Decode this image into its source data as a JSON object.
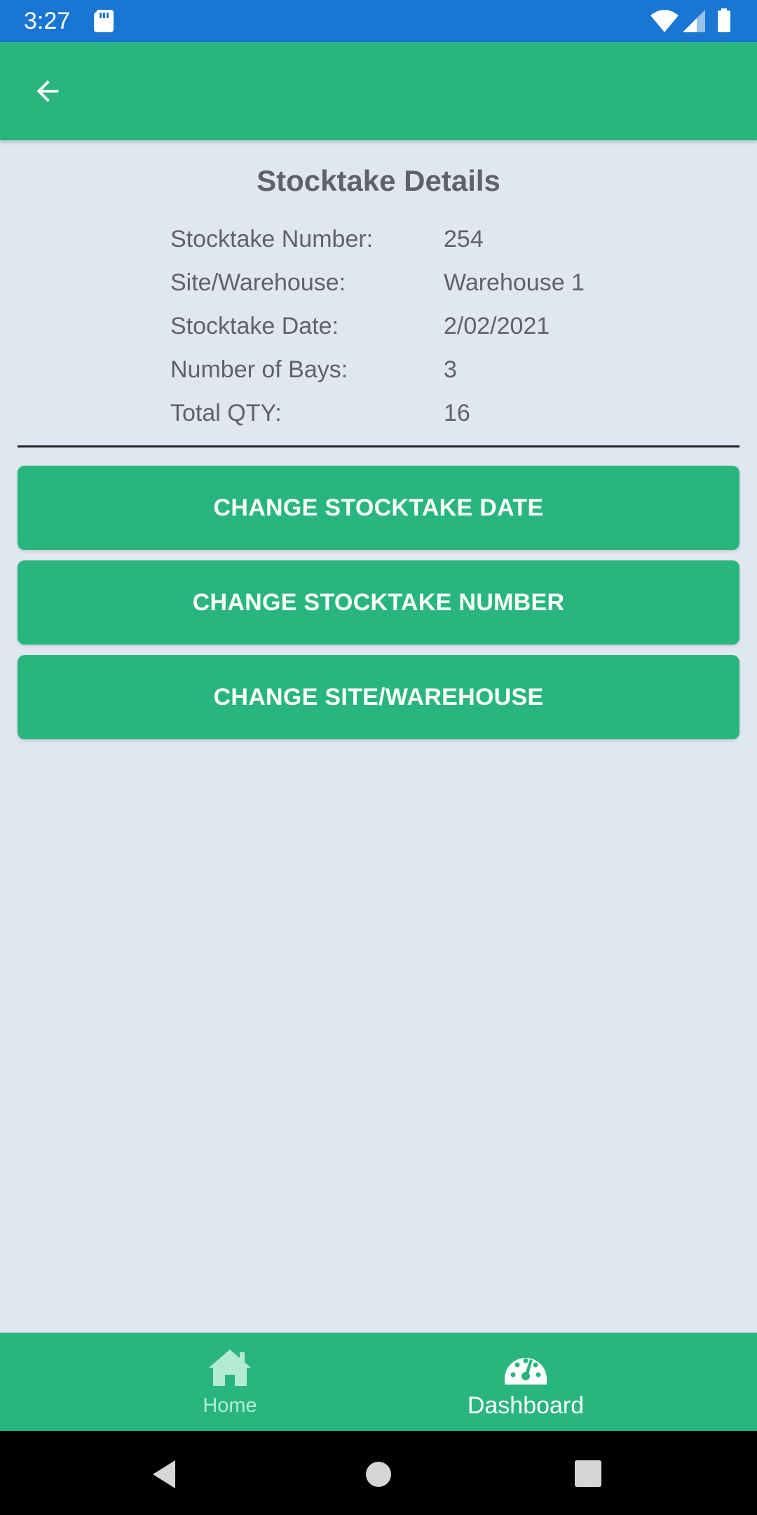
{
  "status_bar": {
    "time": "3:27",
    "icons": [
      "sd-card-icon",
      "wifi-icon",
      "cell-signal-icon",
      "battery-icon"
    ],
    "background_color": "#1976D2"
  },
  "app_bar": {
    "back_icon": "arrow-back-icon",
    "background_color": "#28B67E"
  },
  "page": {
    "title": "Stocktake Details"
  },
  "details": [
    {
      "label": "Stocktake Number:",
      "value": "254"
    },
    {
      "label": "Site/Warehouse:",
      "value": "Warehouse 1"
    },
    {
      "label": "Stocktake Date:",
      "value": "2/02/2021"
    },
    {
      "label": "Number of Bays:",
      "value": "3"
    },
    {
      "label": "Total QTY:",
      "value": "16"
    }
  ],
  "actions": {
    "change_date": "CHANGE STOCKTAKE DATE",
    "change_number": "CHANGE STOCKTAKE NUMBER",
    "change_site": "CHANGE SITE/WAREHOUSE"
  },
  "bottom_nav": {
    "items": [
      {
        "label": "Home",
        "icon": "home-icon",
        "active": false
      },
      {
        "label": "Dashboard",
        "icon": "dashboard-gauge-icon",
        "active": true
      }
    ]
  },
  "system_nav": {
    "icons": [
      "back-triangle-icon",
      "home-circle-icon",
      "recents-square-icon"
    ]
  },
  "colors": {
    "accent": "#28B67E",
    "background": "#E1E7F1",
    "text": "#5F6368"
  }
}
